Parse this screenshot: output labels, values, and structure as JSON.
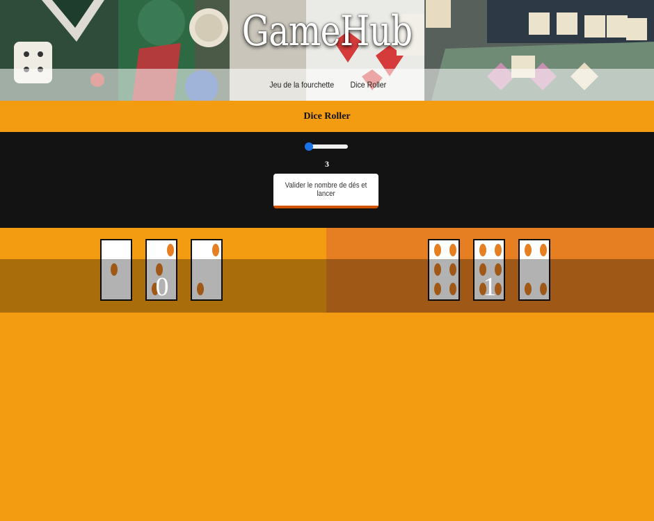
{
  "header": {
    "title": "GameHub",
    "nav": [
      {
        "label": "Jeu de la fourchette"
      },
      {
        "label": "Dice Roller"
      }
    ]
  },
  "section": {
    "title": "Dice Roller"
  },
  "controls": {
    "dice_count": "3",
    "slider_min": "1",
    "slider_max": "20",
    "roll_button_label": "Valider le nombre de dés et lancer"
  },
  "players": [
    {
      "score": "0",
      "dice": [
        1,
        3,
        2
      ]
    },
    {
      "score": "1",
      "dice": [
        6,
        6,
        4
      ]
    }
  ],
  "colors": {
    "page_bg": "#f39c12",
    "player_1_bg": "#f39c12",
    "player_2_bg": "#e67e22",
    "pip": "#e67e22",
    "controls_bg": "#131313",
    "slider_accent": "#1a73e8"
  }
}
